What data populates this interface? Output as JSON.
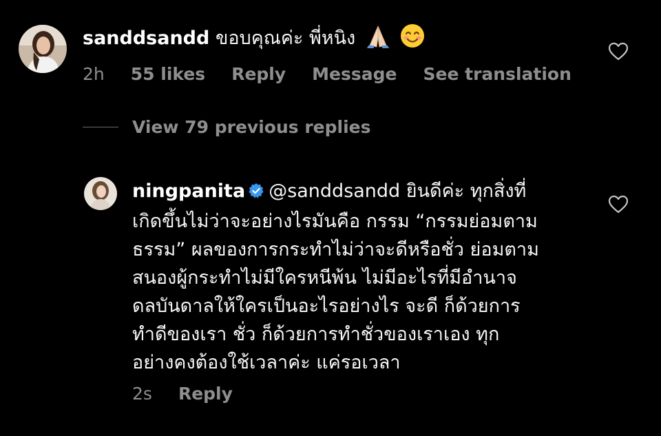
{
  "comment1": {
    "username": "sanddsandd",
    "text": "ขอบคุณค่ะ พี่หนิง",
    "emojis": [
      "folded-hands-icon",
      "smiling-face-icon"
    ],
    "time": "2h",
    "likes": "55 likes",
    "reply_label": "Reply",
    "message_label": "Message",
    "translate_label": "See translation"
  },
  "view_replies": {
    "label": "View 79 previous replies"
  },
  "reply1": {
    "username": "ningpanita",
    "verified": true,
    "lines": [
      "@sanddsandd ยินดีค่ะ ทุกสิ่งที่",
      "เกิดขึ้นไม่ว่าจะอย่างไรมันคือ กรรม “กรรมย่อมตาม",
      "ธรรม” ผลของการกระทำไม่ว่าจะดีหรือชั่ว  ย่อมตาม",
      "สนองผู้กระทำไม่มีใครหนีพ้น ไม่มีอะไรที่มีอำนาจ",
      "ดลบันดาลให้ใครเป็นอะไรอย่างไร  จะดี ก็ด้วยการ",
      "ทำดีของเรา ชั่ว ก็ด้วยการทำชั่วของเราเอง  ทุก",
      "อย่างคงต้องใช้เวลาค่ะ แค่รอเวลา"
    ],
    "time": "2s",
    "reply_label": "Reply"
  },
  "colors": {
    "background": "#000000",
    "text": "#f5f5f5",
    "meta": "#8e8e8e",
    "verified": "#3897f0"
  }
}
